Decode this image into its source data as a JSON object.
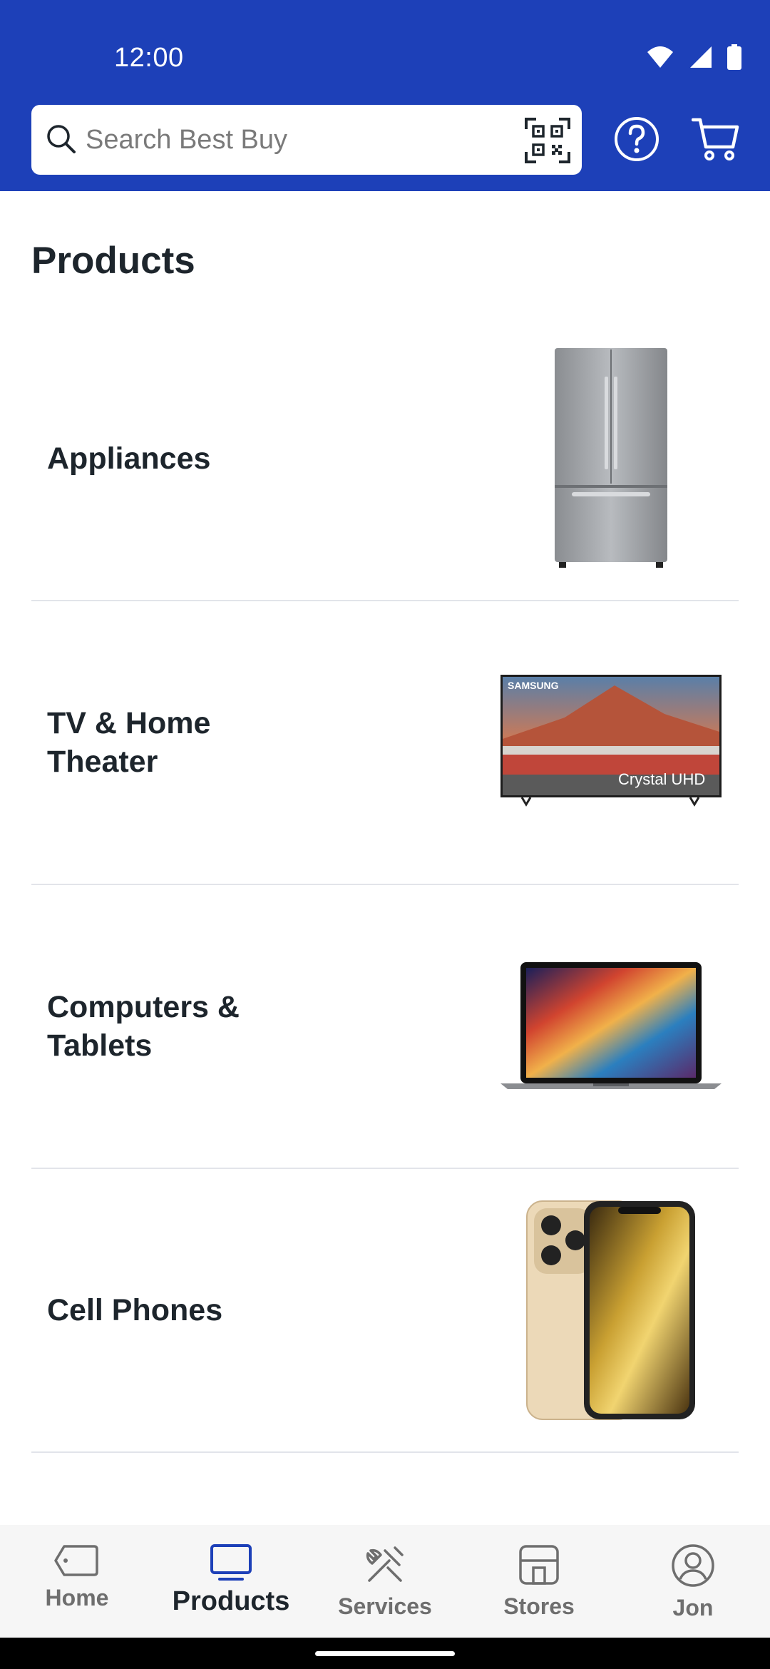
{
  "status_bar": {
    "time": "12:00"
  },
  "search": {
    "placeholder": "Search Best Buy"
  },
  "page": {
    "title": "Products"
  },
  "categories": [
    {
      "label": "Appliances",
      "image": "refrigerator-image"
    },
    {
      "label": "TV & Home Theater",
      "image": "tv-image",
      "tv_brand": "SAMSUNG",
      "tv_caption": "Crystal UHD"
    },
    {
      "label": "Computers & Tablets",
      "image": "laptop-image"
    },
    {
      "label": "Cell Phones",
      "image": "phone-image"
    },
    {
      "label": "",
      "image": "headphones-image"
    }
  ],
  "nav": {
    "items": [
      {
        "label": "Home",
        "icon": "tag-icon"
      },
      {
        "label": "Products",
        "icon": "monitor-icon",
        "active": true
      },
      {
        "label": "Services",
        "icon": "tools-icon"
      },
      {
        "label": "Stores",
        "icon": "store-icon"
      },
      {
        "label": "Jon",
        "icon": "user-icon"
      }
    ]
  },
  "colors": {
    "brand_blue": "#1d40b8",
    "text_dark": "#1d252c",
    "nav_inactive": "#6e6e6e"
  }
}
